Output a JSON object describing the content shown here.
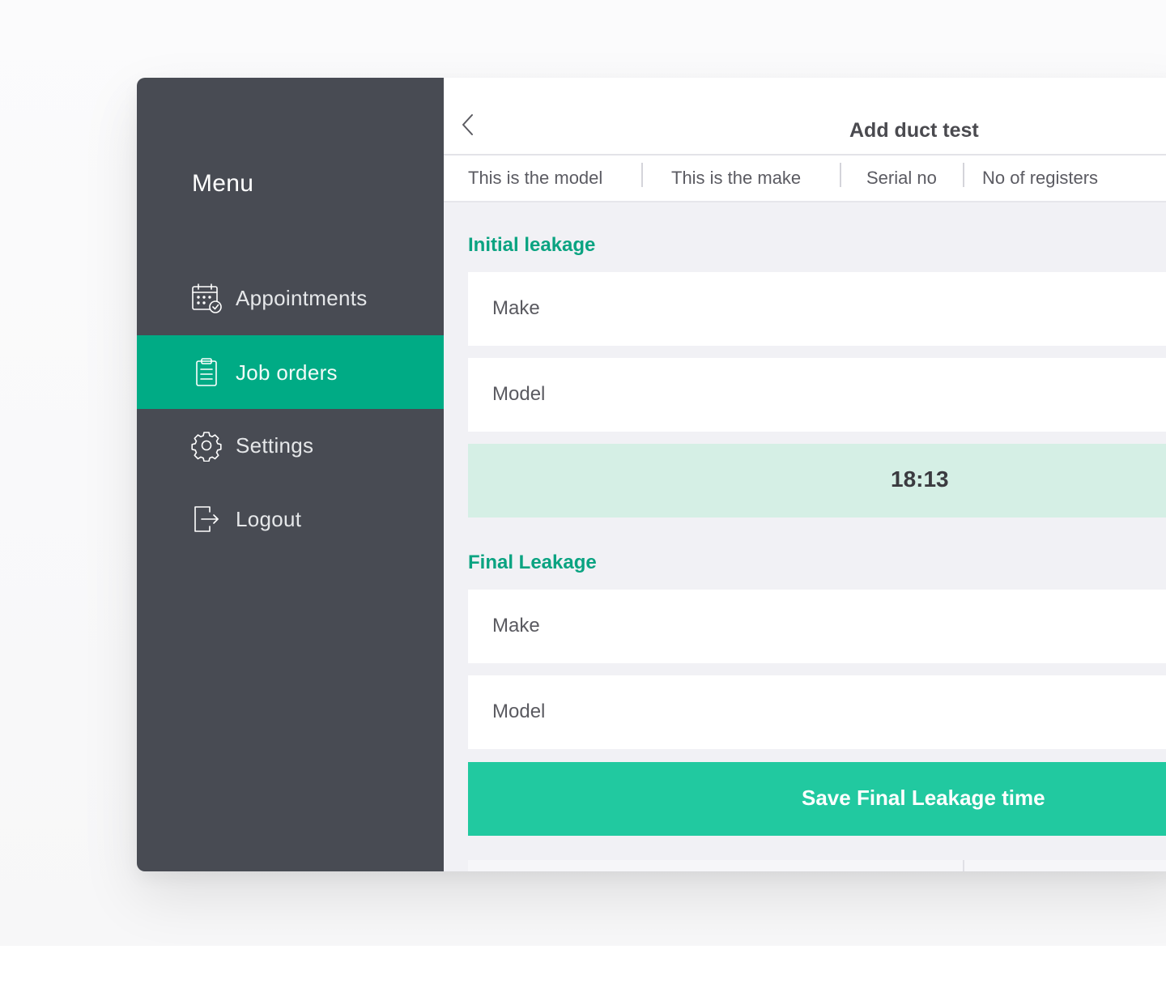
{
  "sidebar": {
    "title": "Menu",
    "items": [
      {
        "label": "Appointments",
        "icon": "calendar-check-icon",
        "active": false
      },
      {
        "label": "Job orders",
        "icon": "clipboard-icon",
        "active": true
      },
      {
        "label": "Settings",
        "icon": "gear-icon",
        "active": false
      },
      {
        "label": "Logout",
        "icon": "logout-icon",
        "active": false
      }
    ]
  },
  "header": {
    "back_icon": "chevron-left-icon",
    "title": "Add duct test"
  },
  "info": {
    "model": "This is the model",
    "make": "This is  the make",
    "serial": "Serial no",
    "registers": "No of registers"
  },
  "initial_leakage": {
    "label": "Initial leakage",
    "make_label": "Make",
    "model_label": "Model",
    "timer": "18:13"
  },
  "final_leakage": {
    "label": "Final Leakage",
    "make_label": "Make",
    "model_label": "Model",
    "save_label": "Save Final Leakage time"
  },
  "colors": {
    "sidebar_bg": "#484b53",
    "active_item": "#00ab85",
    "accent_text": "#0aa381",
    "button_bg": "#21c9a0",
    "timer_bg": "#d5efe5",
    "content_bg": "#f1f1f5"
  }
}
